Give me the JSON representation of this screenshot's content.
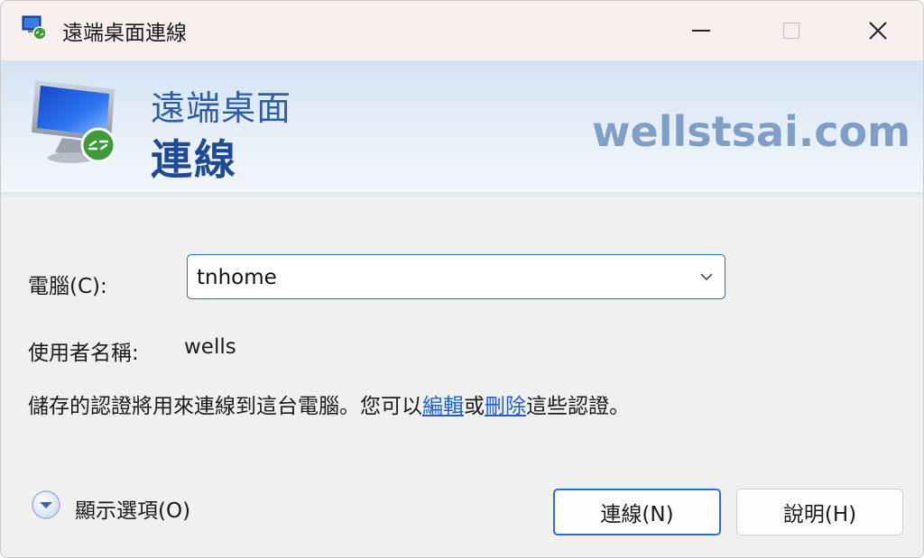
{
  "window": {
    "title": "遠端桌面連線",
    "icon": "remote-desktop-icon",
    "controls": {
      "minimize": "minimize-icon",
      "maximize": "maximize-icon",
      "close": "close-icon"
    }
  },
  "banner": {
    "line1": "遠端桌面",
    "line2": "連線",
    "watermark": "wellstsai.com"
  },
  "form": {
    "computer_label": "電腦(C):",
    "computer_value": "tnhome",
    "username_label": "使用者名稱:",
    "username_value": "wells",
    "info_prefix": "儲存的認證將用來連線到這台電腦。您可以",
    "edit_link": "編輯",
    "info_or": "或",
    "delete_link": "刪除",
    "info_suffix": "這些認證。"
  },
  "footer": {
    "options_label": "顯示選項(O)",
    "connect_button": "連線(N)",
    "help_button": "說明(H)"
  },
  "colors": {
    "accent": "#1f6fd0",
    "heading": "#2f5ea8",
    "link": "#1f5fc7",
    "watermark": "#7f9ec8"
  }
}
